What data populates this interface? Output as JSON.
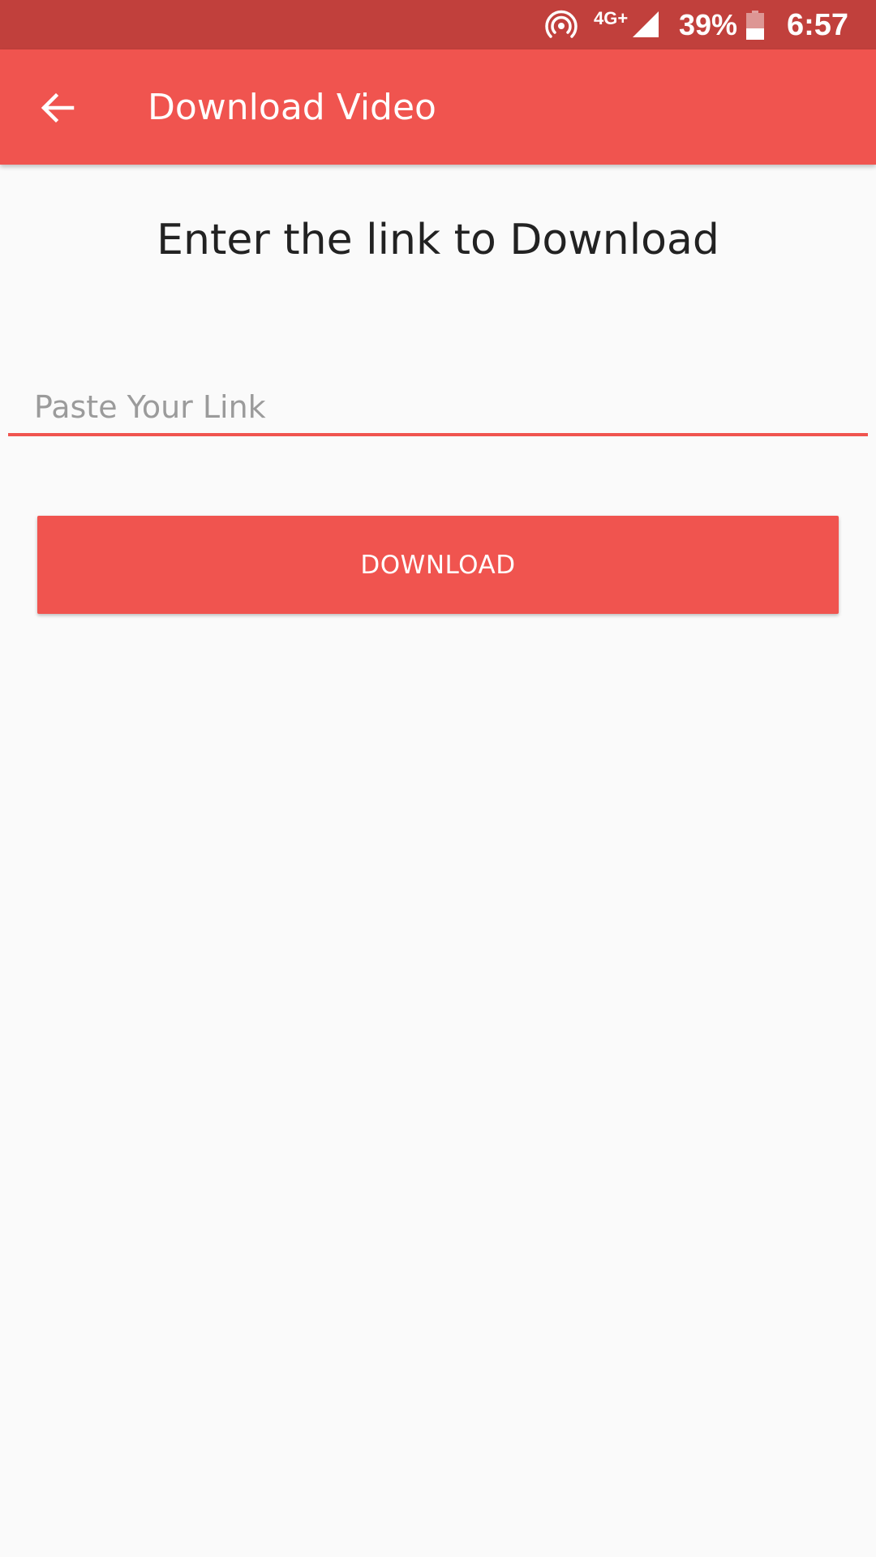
{
  "status_bar": {
    "network": "4G+",
    "battery": "39%",
    "time": "6:57",
    "icons": {
      "hotspot": "hotspot-icon",
      "signal": "cellular-signal-icon",
      "battery": "battery-icon"
    }
  },
  "app_bar": {
    "title": "Download Video",
    "back_icon": "arrow-back-icon"
  },
  "main": {
    "heading": "Enter the link to Download",
    "link_input": {
      "value": "",
      "placeholder": "Paste Your Link"
    },
    "download_button": "DOWNLOAD"
  },
  "colors": {
    "primary": "#f0544f",
    "primary_dark": "#c1403c",
    "background": "#fafafa",
    "text": "#222222"
  }
}
